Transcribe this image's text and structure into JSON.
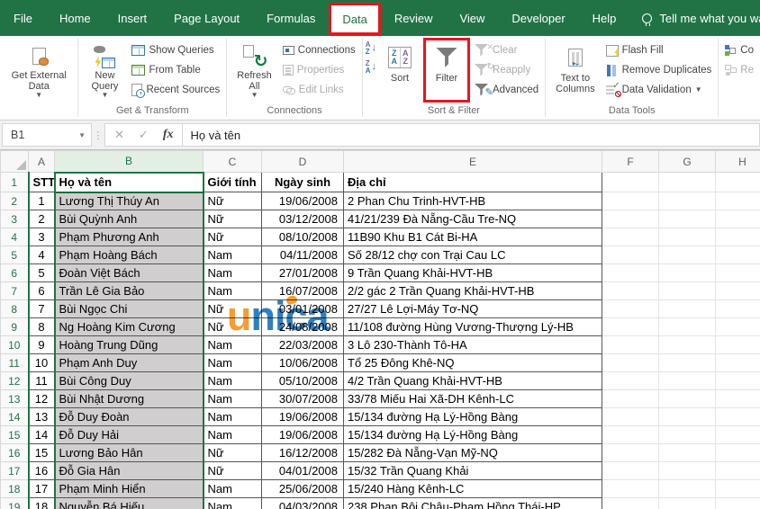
{
  "colors": {
    "excel_green": "#217346",
    "highlight_red": "#E9141D",
    "selected_column_fill": "#D0CECE",
    "selected_header_fill": "#E2EFE2",
    "watermark_orange": "#F7941E",
    "watermark_blue": "#1C75BC"
  },
  "tabs": [
    {
      "label": "File",
      "active": false
    },
    {
      "label": "Home",
      "active": false
    },
    {
      "label": "Insert",
      "active": false
    },
    {
      "label": "Page Layout",
      "active": false
    },
    {
      "label": "Formulas",
      "active": false
    },
    {
      "label": "Data",
      "active": true
    },
    {
      "label": "Review",
      "active": false
    },
    {
      "label": "View",
      "active": false
    },
    {
      "label": "Developer",
      "active": false
    },
    {
      "label": "Help",
      "active": false
    }
  ],
  "tell_me": "Tell me what you want to do",
  "ribbon": {
    "get_external_data": {
      "label": "Get External Data"
    },
    "get_transform": {
      "label": "Get & Transform",
      "new_query": "New Query",
      "show_queries": "Show Queries",
      "from_table": "From Table",
      "recent_sources": "Recent Sources"
    },
    "connections_group": {
      "label": "Connections",
      "refresh_all": "Refresh All",
      "connections": "Connections",
      "properties": "Properties",
      "edit_links": "Edit Links"
    },
    "sort_filter": {
      "label": "Sort & Filter",
      "sort": "Sort",
      "filter": "Filter",
      "clear": "Clear",
      "reapply": "Reapply",
      "advanced": "Advanced"
    },
    "data_tools": {
      "label": "Data Tools",
      "text_to_columns": "Text to Columns",
      "flash_fill": "Flash Fill",
      "remove_duplicates": "Remove Duplicates",
      "data_validation": "Data Validation"
    },
    "right_partial": {
      "consolidate": "Co",
      "relationships": "Re"
    }
  },
  "formula_bar": {
    "name_box": "B1",
    "fx": "fx",
    "content": "Họ và tên"
  },
  "watermark": {
    "orange_part": "u",
    "blue_part": "nica"
  },
  "sheet": {
    "column_letters": [
      "A",
      "B",
      "C",
      "D",
      "E",
      "F",
      "G",
      "H"
    ],
    "selected_column": "B",
    "active_cell": "B1",
    "header_row": [
      "STT",
      "Họ và tên",
      "Giới tính",
      "Ngày sinh",
      "Địa chỉ"
    ],
    "rows": [
      {
        "row": 2,
        "stt": "1",
        "name": "Lương Thị Thúy An",
        "gender": "Nữ",
        "dob": "19/06/2008",
        "address": "2 Phan Chu Trinh-HVT-HB"
      },
      {
        "row": 3,
        "stt": "2",
        "name": "Bùi Quỳnh Anh",
        "gender": "Nữ",
        "dob": "03/12/2008",
        "address": "41/21/239 Đà Nẵng-Cầu Tre-NQ"
      },
      {
        "row": 4,
        "stt": "3",
        "name": "Phạm Phương Anh",
        "gender": "Nữ",
        "dob": "08/10/2008",
        "address": "11B90 Khu B1 Cát Bi-HA"
      },
      {
        "row": 5,
        "stt": "4",
        "name": "Phạm Hoàng Bách",
        "gender": "Nam",
        "dob": "04/11/2008",
        "address": "Số 28/12 chợ con Trại Cau LC"
      },
      {
        "row": 6,
        "stt": "5",
        "name": "Đoàn Việt Bách",
        "gender": "Nam",
        "dob": "27/01/2008",
        "address": "9 Trần Quang Khải-HVT-HB"
      },
      {
        "row": 7,
        "stt": "6",
        "name": "Trần Lê Gia Bảo",
        "gender": "Nam",
        "dob": "16/07/2008",
        "address": "2/2 gác 2 Trần Quang Khải-HVT-HB"
      },
      {
        "row": 8,
        "stt": "7",
        "name": "Bùi Ngọc Chi",
        "gender": "Nữ",
        "dob": "03/01/2008",
        "address": "27/27 Lê Lợi-Máy Tơ-NQ"
      },
      {
        "row": 9,
        "stt": "8",
        "name": "Ng Hoàng Kim Cương",
        "gender": "Nữ",
        "dob": "24/08/2008",
        "address": "11/108 đường Hùng Vương-Thượng Lý-HB"
      },
      {
        "row": 10,
        "stt": "9",
        "name": "Hoàng Trung Dũng",
        "gender": "Nam",
        "dob": "22/03/2008",
        "address": "3 Lô 230-Thành Tô-HA"
      },
      {
        "row": 11,
        "stt": "10",
        "name": "Phạm Anh Duy",
        "gender": "Nam",
        "dob": "10/06/2008",
        "address": "Tổ 25 Đông Khê-NQ"
      },
      {
        "row": 12,
        "stt": "11",
        "name": "Bùi Công Duy",
        "gender": "Nam",
        "dob": "05/10/2008",
        "address": "4/2 Trần Quang Khải-HVT-HB"
      },
      {
        "row": 13,
        "stt": "12",
        "name": "Bùi Nhật Dương",
        "gender": "Nam",
        "dob": "30/07/2008",
        "address": "33/78 Miếu Hai Xã-DH Kênh-LC"
      },
      {
        "row": 14,
        "stt": "13",
        "name": "Đỗ Duy Đoàn",
        "gender": "Nam",
        "dob": "19/06/2008",
        "address": "15/134 đường Hạ Lý-Hồng Bàng"
      },
      {
        "row": 15,
        "stt": "14",
        "name": "Đỗ Duy Hải",
        "gender": "Nam",
        "dob": "19/06/2008",
        "address": "15/134 đường Hạ Lý-Hồng Bàng"
      },
      {
        "row": 16,
        "stt": "15",
        "name": "Lương Bảo Hân",
        "gender": "Nữ",
        "dob": "16/12/2008",
        "address": "15/282 Đà Nẵng-Vạn Mỹ-NQ"
      },
      {
        "row": 17,
        "stt": "16",
        "name": "Đỗ Gia Hân",
        "gender": "Nữ",
        "dob": "04/01/2008",
        "address": "15/32 Trần Quang Khải"
      },
      {
        "row": 18,
        "stt": "17",
        "name": "Phạm Minh Hiển",
        "gender": "Nam",
        "dob": "25/06/2008",
        "address": "15/240 Hàng Kênh-LC"
      },
      {
        "row": 19,
        "stt": "18",
        "name": "Nguyễn Bá Hiếu",
        "gender": "Nam",
        "dob": "04/03/2008",
        "address": "238 Phan Bội Châu-Phạm Hồng Thái-HP"
      }
    ]
  }
}
